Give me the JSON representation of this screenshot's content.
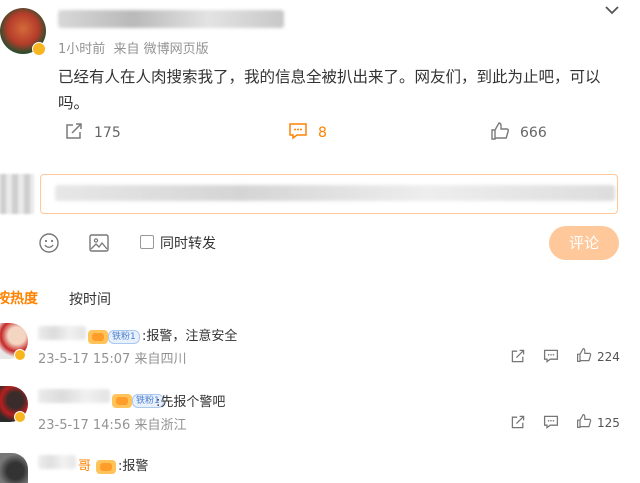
{
  "post": {
    "meta": "1小时前  来自 微博网页版",
    "text": "已经有人在人肉搜索我了，我的信息全被扒出来了。网友们，到此为止吧，可以吗。",
    "forward_count": "175",
    "comment_count": "8",
    "like_count": "666"
  },
  "composer": {
    "sync_label": "同时转发",
    "submit_label": "评论"
  },
  "sort_tabs": [
    "按热度",
    "按时间"
  ],
  "comments": [
    {
      "badge": "铁粉1",
      "text": ":报警，注意安全",
      "meta": "23-5-17 15:07 来自四川",
      "likes": "224"
    },
    {
      "badge": "铁粉1",
      "text": ":先报个警吧",
      "meta": "23-5-17 14:56 来自浙江",
      "likes": "125"
    },
    {
      "name_tail": "哥",
      "text": ":报警"
    }
  ],
  "colors": {
    "accent": "#ff8200",
    "submit_bg": "#ffc89b",
    "grey": "#939393"
  }
}
